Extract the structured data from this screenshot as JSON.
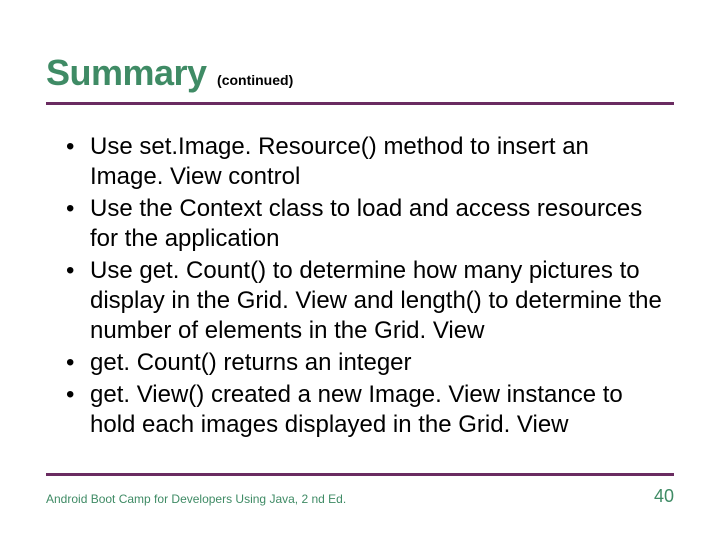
{
  "title": {
    "main": "Summary",
    "sub": "(continued)"
  },
  "bullets": [
    "Use set.Image. Resource() method to insert an Image. View control",
    "Use the Context class to load and access resources for the application",
    "Use get. Count() to determine how many pictures to display in the Grid. View and length() to determine the number of elements in the Grid. View",
    "get. Count() returns an integer",
    "get. View() created a new Image. View instance to hold each images displayed in the Grid. View"
  ],
  "footer": {
    "left": "Android Boot Camp for Developers Using Java, 2 nd Ed.",
    "page": "40"
  },
  "colors": {
    "accent_green": "#3f8b65",
    "rule_purple": "#6a2b61"
  }
}
